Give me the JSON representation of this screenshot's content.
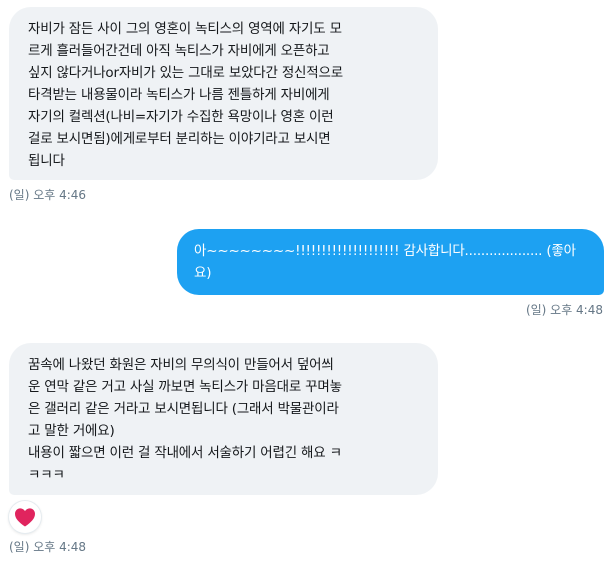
{
  "conversation": {
    "messages": [
      {
        "direction": "received",
        "text": "자비가 잠든 사이 그의 영혼이 녹티스의 영역에 자기도 모\n르게 흘러들어간건데 아직 녹티스가 자비에게 오픈하고\n싶지 않다거나or자비가 있는 그대로 보았다간 정신적으로\n타격받는 내용물이라 녹티스가 나름 젠틀하게 자비에게\n자기의 컬렉션(나비=자기가 수집한 욕망이나 영혼 이런\n걸로 보시면됨)에게로부터 분리하는 이야기라고 보시면\n됩니다",
        "timestamp": "(일) 오후 4:46"
      },
      {
        "direction": "sent",
        "text": "아~~~~~~~~!!!!!!!!!!!!!!!!!!!! 감사합니다................... (좋아\n요)",
        "timestamp": "(일) 오후 4:48"
      },
      {
        "direction": "received",
        "text": "꿈속에 나왔던 화원은 자비의 무의식이 만들어서 덮어씌\n운 연막 같은 거고 사실 까보면 녹티스가 마음대로 꾸며놓\n은 갤러리 같은 거라고 보시면됩니다 (그래서 박물관이라\n고 말한 거에요)\n내용이 짧으면 이런 걸 작내에서 서술하기 어렵긴 해요 ㅋ\nㅋㅋㅋ",
        "timestamp": "(일) 오후 4:48",
        "reaction": "heart-icon"
      }
    ]
  },
  "colors": {
    "sent_bubble": "#1da1f2",
    "received_bubble": "#eff2f5",
    "heart": "#e0245e",
    "timestamp": "#657786"
  }
}
